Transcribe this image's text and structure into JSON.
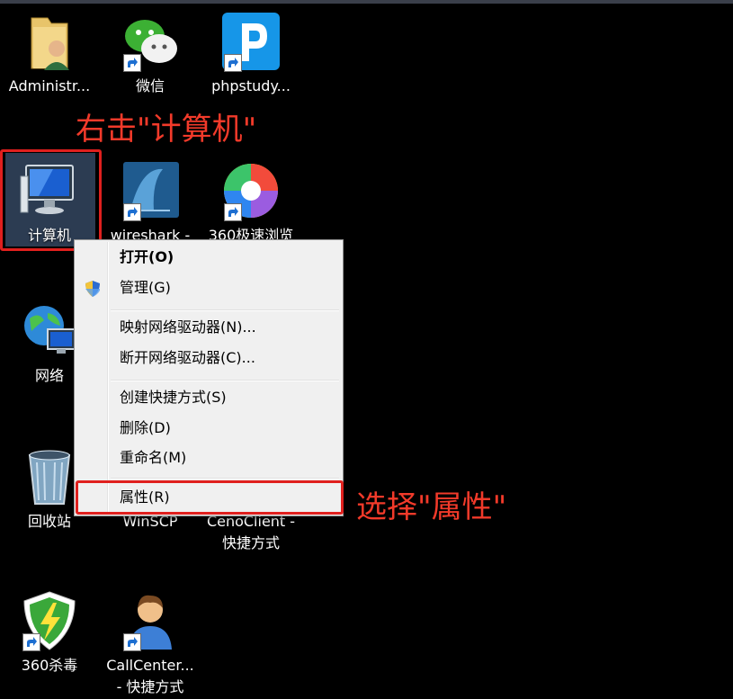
{
  "desktop": {
    "icons": [
      {
        "label": "Administr..."
      },
      {
        "label": "微信"
      },
      {
        "label": "phpstudy..."
      },
      {
        "label": "计算机"
      },
      {
        "label": "wireshark -"
      },
      {
        "label": "360极速浏览"
      },
      {
        "label": "网络"
      },
      {
        "label": "回收站"
      },
      {
        "label": "WinSCP"
      },
      {
        "label": "CenoClient -",
        "label2": "快捷方式"
      },
      {
        "label": "360杀毒"
      },
      {
        "label": "CallCenter...",
        "label2": "- 快捷方式"
      }
    ]
  },
  "annotations": {
    "right_click": "右击\"计算机\"",
    "select": "选择\"属性\""
  },
  "context_menu": {
    "items": [
      {
        "label": "打开(O)"
      },
      {
        "label": "管理(G)"
      },
      {
        "label": "映射网络驱动器(N)..."
      },
      {
        "label": "断开网络驱动器(C)..."
      },
      {
        "label": "创建快捷方式(S)"
      },
      {
        "label": "删除(D)"
      },
      {
        "label": "重命名(M)"
      },
      {
        "label": "属性(R)"
      }
    ]
  },
  "colors": {
    "annotation": "#f23a2a",
    "highlight_box": "#e0201e",
    "desktop_bg": "#000000",
    "menu_bg": "#f0f0f0"
  }
}
